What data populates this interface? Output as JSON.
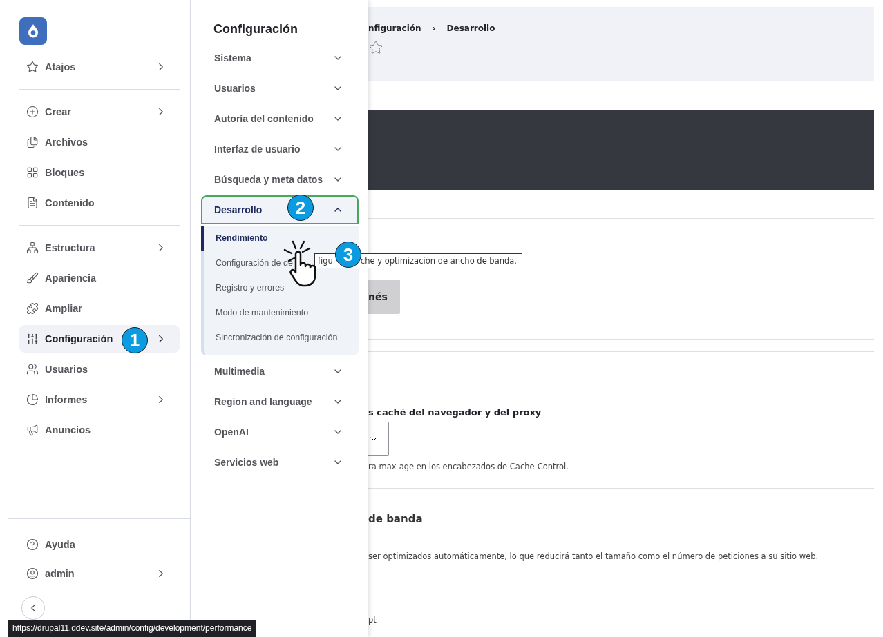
{
  "sidebar": {
    "groups": [
      [
        {
          "label": "Atajos",
          "has_submenu": true,
          "selected": false
        }
      ],
      [
        {
          "label": "Crear",
          "has_submenu": true,
          "selected": false
        },
        {
          "label": "Archivos",
          "has_submenu": false,
          "selected": false
        },
        {
          "label": "Bloques",
          "has_submenu": false,
          "selected": false
        },
        {
          "label": "Contenido",
          "has_submenu": false,
          "selected": false
        }
      ],
      [
        {
          "label": "Estructura",
          "has_submenu": true,
          "selected": false
        },
        {
          "label": "Apariencia",
          "has_submenu": false,
          "selected": false
        },
        {
          "label": "Ampliar",
          "has_submenu": false,
          "selected": false
        },
        {
          "label": "Configuración",
          "has_submenu": true,
          "selected": true,
          "annotation": "1"
        },
        {
          "label": "Usuarios",
          "has_submenu": false,
          "selected": false
        },
        {
          "label": "Informes",
          "has_submenu": true,
          "selected": false
        },
        {
          "label": "Anuncios",
          "has_submenu": false,
          "selected": false
        }
      ]
    ],
    "footer_items": [
      {
        "label": "Ayuda",
        "has_submenu": false
      },
      {
        "label": "admin",
        "has_submenu": true
      }
    ]
  },
  "submenu": {
    "title": "Configuración",
    "sections": [
      {
        "label": "Sistema",
        "expanded": false
      },
      {
        "label": "Usuarios",
        "expanded": false
      },
      {
        "label": "Autoría del contenido",
        "expanded": false
      },
      {
        "label": "Interfaz de usuario",
        "expanded": false
      },
      {
        "label": "Búsqueda y meta datos",
        "expanded": false
      },
      {
        "label": "Desarrollo",
        "expanded": true,
        "annotation": "2",
        "children": [
          {
            "label": "Rendimiento",
            "selected": true
          },
          {
            "label": "Configuración de de",
            "selected": false
          },
          {
            "label": "Registro y errores",
            "selected": false
          },
          {
            "label": "Modo de mantenimiento",
            "selected": false
          },
          {
            "label": "Sincronización de configuración",
            "selected": false
          }
        ]
      },
      {
        "label": "Multimedia",
        "expanded": false
      },
      {
        "label": "Region and language",
        "expanded": false
      },
      {
        "label": "OpenAI",
        "expanded": false
      },
      {
        "label": "Servicios web",
        "expanded": false
      }
    ]
  },
  "main": {
    "breadcrumb": [
      "nfiguración",
      "Desarrollo"
    ],
    "breadcrumb_separator": "›",
    "button": "nés",
    "field_label": "s caché del navegador y del proxy",
    "field_description": "ra max-age en los encabezados de Cache-Control.",
    "section_heading": "de banda",
    "section_description": "ser optimizados automáticamente, lo que reducirá tanto el tamaño como el número de peticiones a su sitio web.",
    "trailing_text": "pt"
  },
  "tooltip": "che y optimización de ancho de banda.",
  "tooltip_covered": "figu",
  "pointer_annotation": "3",
  "status_bar": "https://drupal11.ddev.site/admin/config/development/performance"
}
